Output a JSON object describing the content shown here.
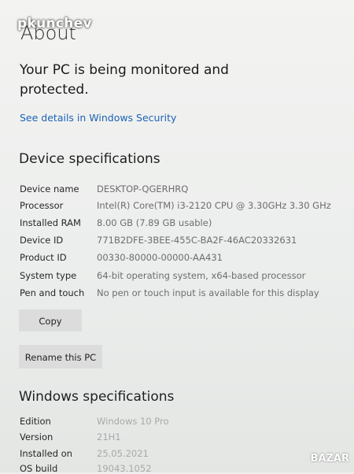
{
  "watermark": "pkunchev",
  "page": {
    "title": "About",
    "protection_text": "Your PC is being monitored and protected.",
    "security_link": "See details in Windows Security"
  },
  "device_specs": {
    "title": "Device specifications",
    "rows": [
      {
        "label": "Device name",
        "value": "DESKTOP-QGERHRQ"
      },
      {
        "label": "Processor",
        "value": "Intel(R) Core(TM) i3-2120 CPU @ 3.30GHz   3.30 GHz"
      },
      {
        "label": "Installed RAM",
        "value": "8.00 GB (7.89 GB usable)"
      },
      {
        "label": "Device ID",
        "value": "771B2DFE-3BEE-455C-BA2F-46AC20332631"
      },
      {
        "label": "Product ID",
        "value": "00330-80000-00000-AA431"
      },
      {
        "label": "System type",
        "value": "64-bit operating system, x64-based processor"
      },
      {
        "label": "Pen and touch",
        "value": "No pen or touch input is available for this display"
      }
    ],
    "copy_button": "Copy",
    "rename_button": "Rename this PC"
  },
  "windows_specs": {
    "title": "Windows specifications",
    "rows": [
      {
        "label": "Edition",
        "value": "Windows 10 Pro"
      },
      {
        "label": "Version",
        "value": "21H1"
      },
      {
        "label": "Installed on",
        "value": "25.05.2021"
      },
      {
        "label": "OS build",
        "value": "19043.1052"
      }
    ]
  },
  "logo": "BAZAR"
}
